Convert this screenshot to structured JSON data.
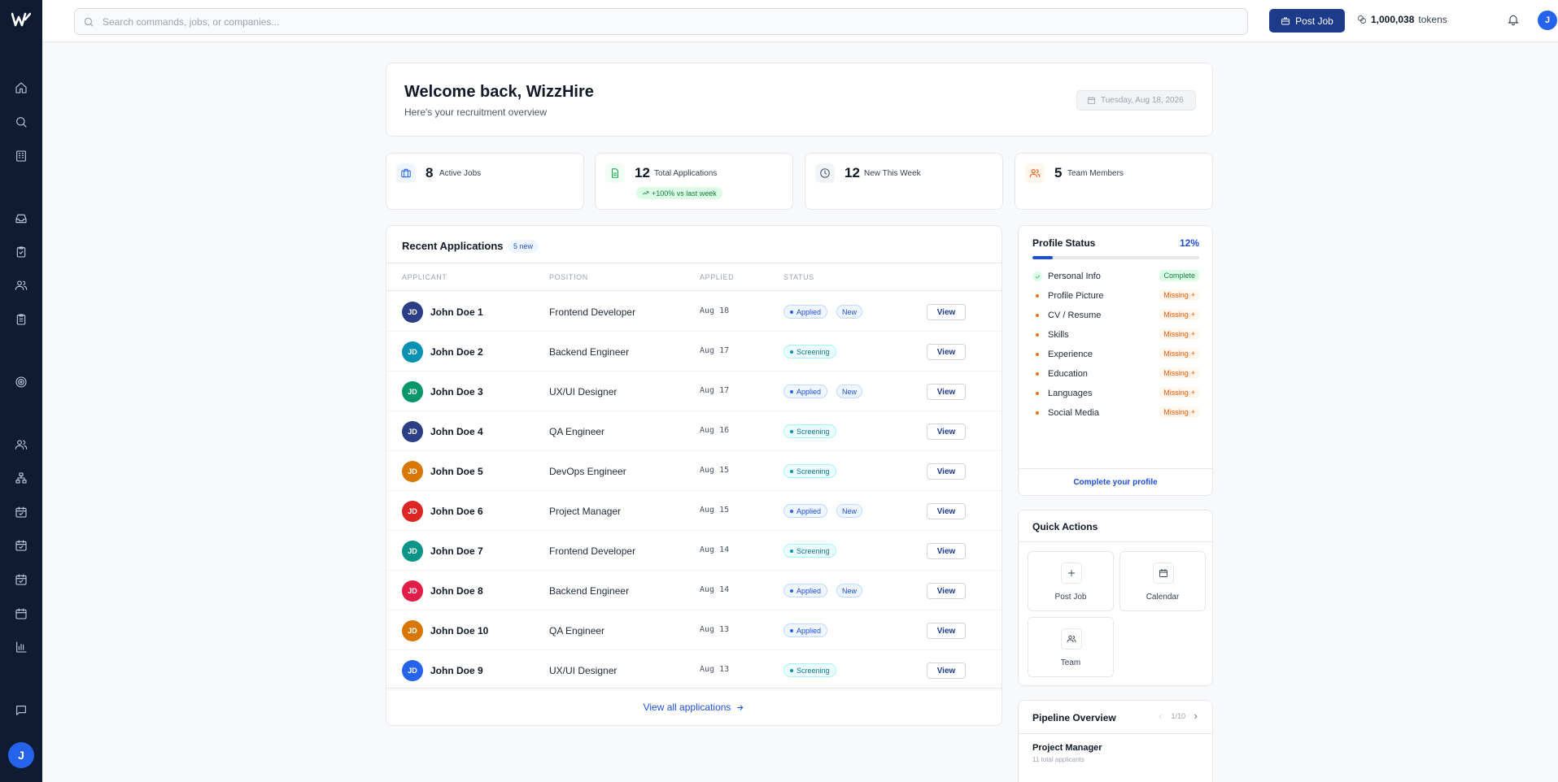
{
  "app": {
    "logo_icon": "wizzhire-logo",
    "brand_color": "#1e3a8a",
    "sidebar_color": "#0f1b33"
  },
  "search": {
    "placeholder": "Search commands, jobs, or companies..."
  },
  "topbar": {
    "post_job_label": "Post Job",
    "tokens_value": "1,000,038",
    "tokens_label": "tokens",
    "user_initial": "J"
  },
  "sidebar": {
    "user_initial": "J",
    "icons": [
      "home-icon",
      "search-icon",
      "building-icon",
      "inbox-icon",
      "clipboard-check-icon",
      "users-icon",
      "clipboard-icon",
      "target-icon",
      "team-icon",
      "org-chart-icon",
      "calendar-check-icon",
      "calendar-check-icon",
      "calendar-check-icon",
      "calendar-icon",
      "bar-chart-icon",
      "message-icon"
    ]
  },
  "welcome": {
    "title": "Welcome back, WizzHire",
    "subtitle": "Here's your recruitment overview",
    "date": "Tuesday, Aug 18, 2026"
  },
  "stats": [
    {
      "value": "8",
      "label": "Active Jobs",
      "icon": "briefcase-icon",
      "color": "#2563eb",
      "bg": "#eff6ff"
    },
    {
      "value": "12",
      "label": "Total Applications",
      "icon": "document-icon",
      "color": "#16a34a",
      "bg": "#f0fdf4",
      "trend": "+100% vs last week"
    },
    {
      "value": "12",
      "label": "New This Week",
      "icon": "clock-icon",
      "color": "#475569",
      "bg": "#f1f5f9"
    },
    {
      "value": "5",
      "label": "Team Members",
      "icon": "users-icon",
      "color": "#ea580c",
      "bg": "#fff7ed"
    }
  ],
  "recent": {
    "title": "Recent Applications",
    "badge": "5 new",
    "columns": [
      "APPLICANT",
      "POSITION",
      "APPLIED",
      "STATUS"
    ],
    "view_label": "View",
    "new_label": "New",
    "rows": [
      {
        "initials": "JD",
        "name": "John Doe 1",
        "position": "Frontend Developer",
        "date": "Aug 18",
        "status": "Applied",
        "is_new": true,
        "color": "#2c3e86"
      },
      {
        "initials": "JD",
        "name": "John Doe 2",
        "position": "Backend Engineer",
        "date": "Aug 17",
        "status": "Screening",
        "is_new": false,
        "color": "#0891b2"
      },
      {
        "initials": "JD",
        "name": "John Doe 3",
        "position": "UX/UI Designer",
        "date": "Aug 17",
        "status": "Applied",
        "is_new": true,
        "color": "#059669"
      },
      {
        "initials": "JD",
        "name": "John Doe 4",
        "position": "QA Engineer",
        "date": "Aug 16",
        "status": "Screening",
        "is_new": false,
        "color": "#2c3e86"
      },
      {
        "initials": "JD",
        "name": "John Doe 5",
        "position": "DevOps Engineer",
        "date": "Aug 15",
        "status": "Screening",
        "is_new": false,
        "color": "#d97706"
      },
      {
        "initials": "JD",
        "name": "John Doe 6",
        "position": "Project Manager",
        "date": "Aug 15",
        "status": "Applied",
        "is_new": true,
        "color": "#dc2626"
      },
      {
        "initials": "JD",
        "name": "John Doe 7",
        "position": "Frontend Developer",
        "date": "Aug 14",
        "status": "Screening",
        "is_new": false,
        "color": "#0d9488"
      },
      {
        "initials": "JD",
        "name": "John Doe 8",
        "position": "Backend Engineer",
        "date": "Aug 14",
        "status": "Applied",
        "is_new": true,
        "color": "#e11d48"
      },
      {
        "initials": "JD",
        "name": "John Doe 10",
        "position": "QA Engineer",
        "date": "Aug 13",
        "status": "Applied",
        "is_new": false,
        "color": "#d97706"
      },
      {
        "initials": "JD",
        "name": "John Doe 9",
        "position": "UX/UI Designer",
        "date": "Aug 13",
        "status": "Screening",
        "is_new": false,
        "color": "#2563eb"
      }
    ],
    "view_all": "View all applications"
  },
  "profile": {
    "title": "Profile Status",
    "percent": "12%",
    "progress": 0.12,
    "items": [
      {
        "label": "Personal Info",
        "status": "Complete"
      },
      {
        "label": "Profile Picture",
        "status": "Missing"
      },
      {
        "label": "CV / Resume",
        "status": "Missing"
      },
      {
        "label": "Skills",
        "status": "Missing"
      },
      {
        "label": "Experience",
        "status": "Missing"
      },
      {
        "label": "Education",
        "status": "Missing"
      },
      {
        "label": "Languages",
        "status": "Missing"
      },
      {
        "label": "Social Media",
        "status": "Missing"
      }
    ],
    "cta": "Complete your profile"
  },
  "quick_actions": {
    "title": "Quick Actions",
    "items": [
      {
        "label": "Post Job",
        "icon": "plus-icon"
      },
      {
        "label": "Calendar",
        "icon": "calendar-icon"
      },
      {
        "label": "Team",
        "icon": "users-icon"
      }
    ]
  },
  "pipeline": {
    "title": "Pipeline Overview",
    "pager": "1/10",
    "job": "Project Manager",
    "sub": "11 total applicants"
  }
}
